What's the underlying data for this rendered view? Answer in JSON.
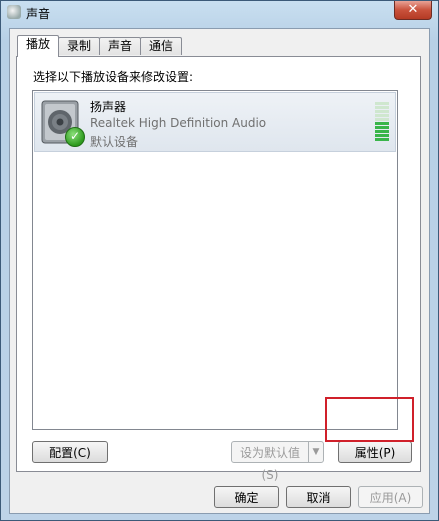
{
  "window": {
    "title": "声音",
    "close_glyph": "✕"
  },
  "tabs": [
    {
      "label": "播放",
      "active": true
    },
    {
      "label": "录制",
      "active": false
    },
    {
      "label": "声音",
      "active": false
    },
    {
      "label": "通信",
      "active": false
    }
  ],
  "playback": {
    "instruction": "选择以下播放设备来修改设置:",
    "devices": [
      {
        "name": "扬声器",
        "driver": "Realtek High Definition Audio",
        "status": "默认设备",
        "icon": "speaker-icon",
        "badge": "default-check-icon",
        "check_glyph": "✓"
      }
    ],
    "configure_button": "配置(C)",
    "set_default_button": "设为默认值(S)",
    "dropdown_glyph": "▼",
    "properties_button": "属性(P)"
  },
  "footer": {
    "ok_button": "确定",
    "cancel_button": "取消",
    "apply_button": "应用(A)"
  },
  "colors": {
    "highlight": "#d0202a",
    "level_active": "#39b54a",
    "check_green": "#2d9a1e"
  }
}
